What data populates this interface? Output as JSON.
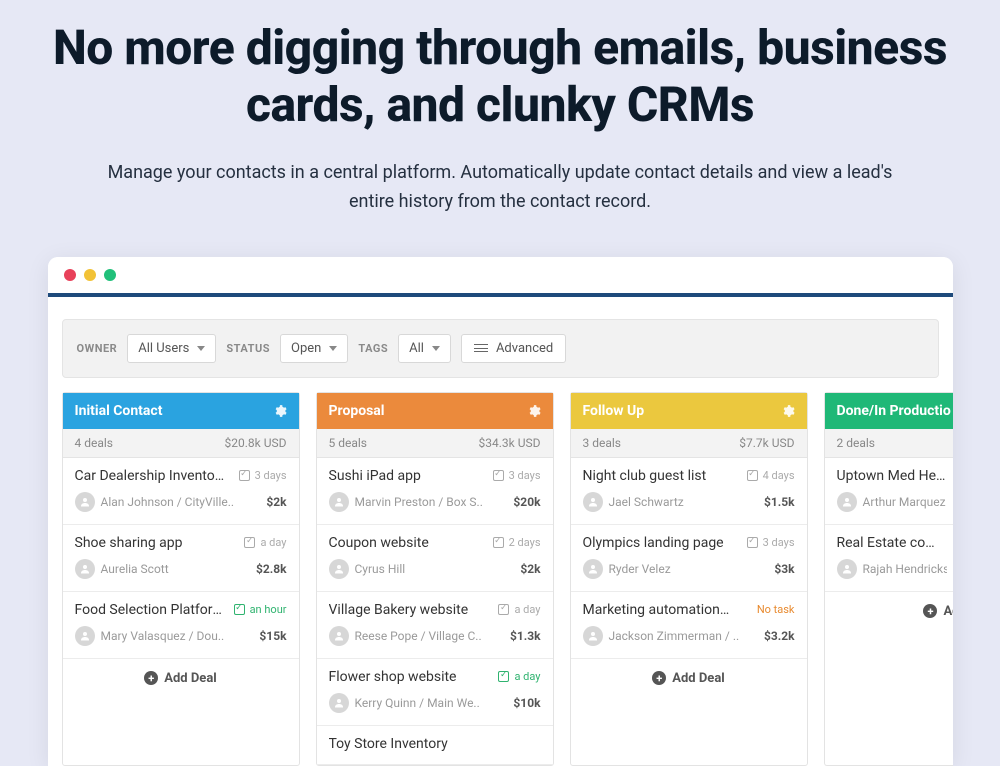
{
  "hero": {
    "headline": "No more digging through emails, business cards, and clunky CRMs",
    "sub": "Manage your contacts in a central platform. Automatically update contact details and view a lead's entire history from the contact record."
  },
  "filters": {
    "owner_label": "OWNER",
    "owner_value": "All Users",
    "status_label": "STATUS",
    "status_value": "Open",
    "tags_label": "TAGS",
    "tags_value": "All",
    "advanced_label": "Advanced"
  },
  "add_deal_label": "Add Deal",
  "add_deal_short": "Ad",
  "columns": [
    {
      "title": "Initial Contact",
      "color": "c-blue",
      "deals_text": "4 deals",
      "total_text": "$20.8k USD",
      "cards": [
        {
          "title": "Car Dealership Inventory",
          "status_class": "grey",
          "status_time": "3 days",
          "person": "Alan Johnson / CityVille..",
          "amount": "$2k"
        },
        {
          "title": "Shoe sharing app",
          "status_class": "grey",
          "status_time": "a day",
          "person": "Aurelia Scott",
          "amount": "$2.8k"
        },
        {
          "title": "Food Selection Platform",
          "status_class": "g",
          "status_time": "an hour",
          "person": "Mary Valasquez / Dou..",
          "amount": "$15k"
        }
      ],
      "show_add": true
    },
    {
      "title": "Proposal",
      "color": "c-orange",
      "deals_text": "5 deals",
      "total_text": "$34.3k USD",
      "cards": [
        {
          "title": "Sushi iPad app",
          "status_class": "grey",
          "status_time": "3 days",
          "person": "Marvin Preston / Box S..",
          "amount": "$20k"
        },
        {
          "title": "Coupon website",
          "status_class": "grey",
          "status_time": "2 days",
          "person": "Cyrus Hill",
          "amount": "$2k"
        },
        {
          "title": "Village Bakery website",
          "status_class": "grey",
          "status_time": "a day",
          "person": "Reese Pope / Village C..",
          "amount": "$1.3k"
        },
        {
          "title": "Flower shop website",
          "status_class": "g",
          "status_time": "a day",
          "person": "Kerry Quinn / Main We..",
          "amount": "$10k"
        },
        {
          "title": "Toy Store Inventory",
          "status_class": "",
          "status_time": "",
          "person": "",
          "amount": ""
        }
      ],
      "show_add": false
    },
    {
      "title": "Follow Up",
      "color": "c-yellow",
      "deals_text": "3 deals",
      "total_text": "$7.7k USD",
      "cards": [
        {
          "title": "Night club guest list",
          "status_class": "grey",
          "status_time": "4 days",
          "person": "Jael Schwartz",
          "amount": "$1.5k"
        },
        {
          "title": "Olympics landing page",
          "status_class": "grey",
          "status_time": "3 days",
          "person": "Ryder Velez",
          "amount": "$3k"
        },
        {
          "title": "Marketing automation demo",
          "status_class": "orange",
          "no_check": true,
          "status_time": "No task",
          "person": "Jackson Zimmerman / ..",
          "amount": "$3.2k"
        }
      ],
      "show_add": true
    },
    {
      "title": "Done/In Productio",
      "color": "c-green",
      "deals_text": "2 deals",
      "total_text": "",
      "cards": [
        {
          "title": "Uptown Med Heal",
          "status_class": "",
          "status_time": "",
          "person": "Arthur Marquez",
          "amount": ""
        },
        {
          "title": "Real Estate compa",
          "status_class": "",
          "status_time": "",
          "person": "Rajah Hendricks",
          "amount": ""
        }
      ],
      "show_add": true,
      "last": true
    }
  ]
}
